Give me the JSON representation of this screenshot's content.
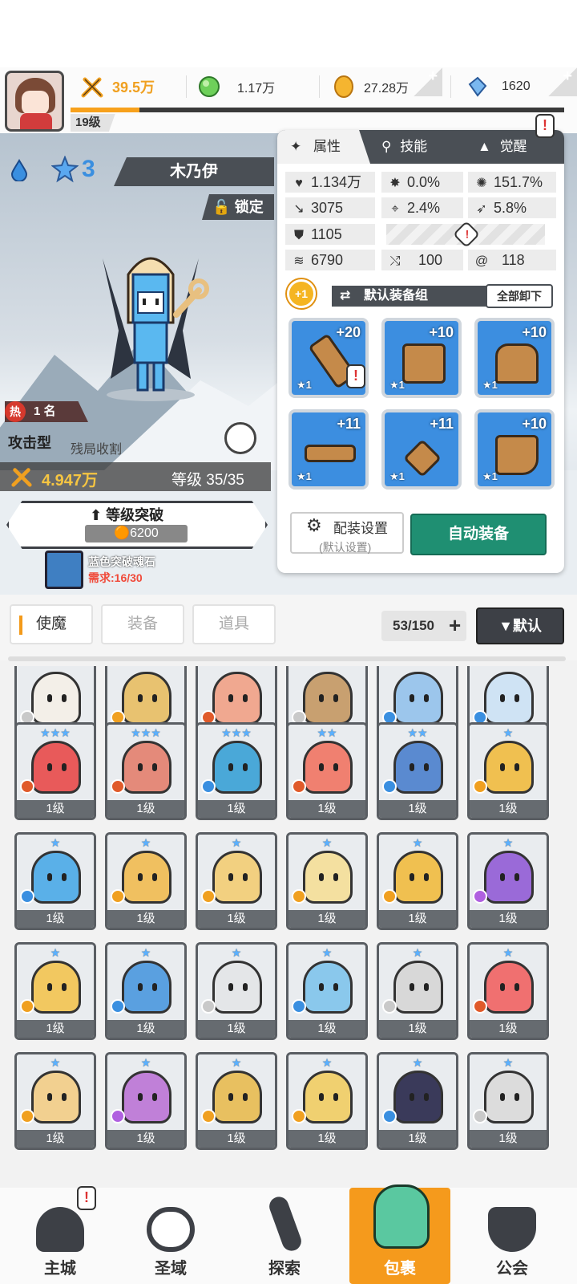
{
  "header": {
    "combat_power": "39.5万",
    "gems": "1.17万",
    "gold": "27.28万",
    "crystals": "1620",
    "player_level": "19级",
    "xp_progress": 0.14
  },
  "hero": {
    "name": "木乃伊",
    "star_level": "3",
    "lock_label": "锁定",
    "hot_label": "热",
    "rank": "1 名",
    "type": "攻击型",
    "trait": "残局收割",
    "power": "4.947万",
    "level": "等级 35/35",
    "breakthrough_label": "等级突破",
    "breakthrough_cost": "6200",
    "material_name": "蓝色突破魂石",
    "material_need": "需求:16/30"
  },
  "panel": {
    "tabs": [
      {
        "label": "属性",
        "icon": "attribute-icon"
      },
      {
        "label": "技能",
        "icon": "skill-icon"
      },
      {
        "label": "觉醒",
        "icon": "awaken-icon"
      }
    ],
    "stats": {
      "hp": "1.134万",
      "crit_rate": "0.0%",
      "crit_damage": "151.7%",
      "attack": "3075",
      "accuracy": "2.4%",
      "dodge": "5.8%",
      "defense": "1105",
      "speed": "6790",
      "stat_a": "100",
      "stat_b": "118"
    },
    "set_plus": "+1",
    "set_name": "默认装备组",
    "unequip_all": "全部卸下",
    "equipment": [
      {
        "enhance": "+20",
        "rank": "★1",
        "item": "sword",
        "alert": true
      },
      {
        "enhance": "+10",
        "rank": "★1",
        "item": "helmet",
        "alert": false
      },
      {
        "enhance": "+10",
        "rank": "★1",
        "item": "armor",
        "alert": false
      },
      {
        "enhance": "+11",
        "rank": "★1",
        "item": "belt",
        "alert": false
      },
      {
        "enhance": "+11",
        "rank": "★1",
        "item": "necklace",
        "alert": false
      },
      {
        "enhance": "+10",
        "rank": "★1",
        "item": "boots",
        "alert": false
      }
    ],
    "config_label": "配装设置",
    "config_sub": "(默认设置)",
    "auto_equip": "自动装备"
  },
  "bag": {
    "tabs": [
      "使魔",
      "装备",
      "道具"
    ],
    "count": "53/150",
    "sort_label": "▼默认"
  },
  "grid": {
    "level_label": "1级",
    "rows": [
      [
        {
          "stars": "",
          "color": "#f3efe8",
          "el": "#c9c9c9"
        },
        {
          "stars": "",
          "color": "#e8c270",
          "el": "#f0a020"
        },
        {
          "stars": "",
          "color": "#f0a890",
          "el": "#e05a2a"
        },
        {
          "stars": "",
          "color": "#c8a070",
          "el": "#c9c9c9"
        },
        {
          "stars": "",
          "color": "#9cc6ec",
          "el": "#3a8fe0"
        },
        {
          "stars": "",
          "color": "#cfe3f4",
          "el": "#3a8fe0"
        }
      ],
      [
        {
          "stars": "★★★",
          "color": "#e85a5a",
          "el": "#e05a2a"
        },
        {
          "stars": "★★★",
          "color": "#e48a7a",
          "el": "#e05a2a"
        },
        {
          "stars": "★★★",
          "color": "#4aa8d8",
          "el": "#3a8fe0"
        },
        {
          "stars": "★★",
          "color": "#f08070",
          "el": "#e05a2a"
        },
        {
          "stars": "★★",
          "color": "#5a8ad0",
          "el": "#3a8fe0"
        },
        {
          "stars": "★",
          "color": "#f0c050",
          "el": "#f0a020"
        }
      ],
      [
        {
          "stars": "★",
          "color": "#5ab0e8",
          "el": "#3a8fe0"
        },
        {
          "stars": "★",
          "color": "#f0c060",
          "el": "#f0a020"
        },
        {
          "stars": "★",
          "color": "#f2d080",
          "el": "#f0a020"
        },
        {
          "stars": "★",
          "color": "#f4e0a0",
          "el": "#f0a020"
        },
        {
          "stars": "★",
          "color": "#f0c050",
          "el": "#f0a020"
        },
        {
          "stars": "★",
          "color": "#9a6ad8",
          "el": "#b060e0"
        }
      ],
      [
        {
          "stars": "★",
          "color": "#f2c860",
          "el": "#f0a020"
        },
        {
          "stars": "★",
          "color": "#5aa0e0",
          "el": "#3a8fe0"
        },
        {
          "stars": "★",
          "color": "#e4e6e8",
          "el": "#c9c9c9"
        },
        {
          "stars": "★",
          "color": "#8ac8ec",
          "el": "#3a8fe0"
        },
        {
          "stars": "★",
          "color": "#d8d8d8",
          "el": "#c9c9c9"
        },
        {
          "stars": "★",
          "color": "#f07070",
          "el": "#e05a2a"
        }
      ],
      [
        {
          "stars": "★",
          "color": "#f2d090",
          "el": "#f0a020"
        },
        {
          "stars": "★",
          "color": "#c080d8",
          "el": "#b060e0"
        },
        {
          "stars": "★",
          "color": "#e8c060",
          "el": "#f0a020"
        },
        {
          "stars": "★",
          "color": "#f0d070",
          "el": "#f0a020"
        },
        {
          "stars": "★",
          "color": "#3a3a5a",
          "el": "#3a8fe0"
        },
        {
          "stars": "★",
          "color": "#dcdcdc",
          "el": "#c9c9c9"
        }
      ]
    ]
  },
  "nav": [
    {
      "label": "主城",
      "icon": "castle-icon"
    },
    {
      "label": "圣域",
      "icon": "vortex-icon"
    },
    {
      "label": "探索",
      "icon": "sword-icon"
    },
    {
      "label": "包裹",
      "icon": "bag-icon"
    },
    {
      "label": "公会",
      "icon": "guild-icon"
    }
  ],
  "colors": {
    "accent": "#f59a1c",
    "dark": "#4a4f55",
    "auto_equip": "#1f8f72",
    "equip_slot": "#3c8ee0"
  }
}
